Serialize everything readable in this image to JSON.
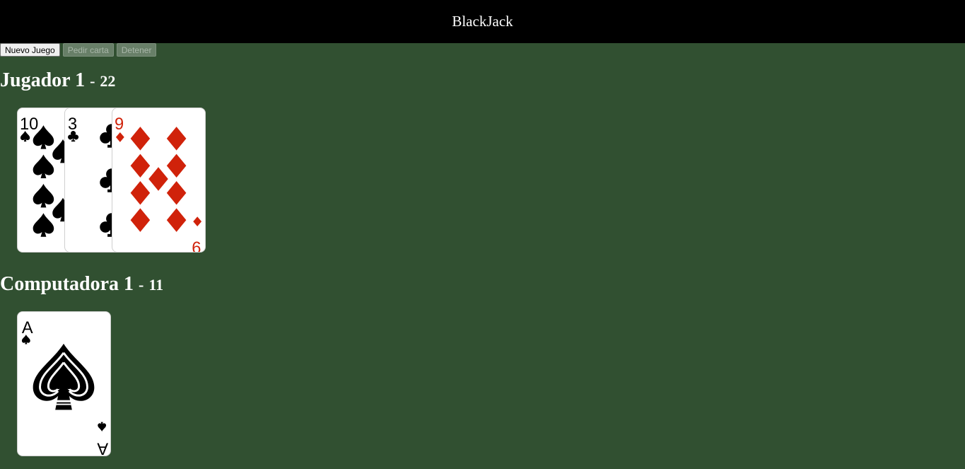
{
  "header": {
    "title": "BlackJack"
  },
  "controls": {
    "new_game": "Nuevo Juego",
    "hit": "Pedir carta",
    "stand": "Detener"
  },
  "player": {
    "name": "Jugador 1",
    "separator": "-",
    "score": "22",
    "cards": [
      {
        "rank": "10",
        "suit": "spades"
      },
      {
        "rank": "3",
        "suit": "clubs"
      },
      {
        "rank": "9",
        "suit": "diamonds"
      }
    ]
  },
  "computer": {
    "name": "Computadora 1",
    "separator": "-",
    "score": "11",
    "cards": [
      {
        "rank": "A",
        "suit": "spades"
      }
    ]
  },
  "colors": {
    "table": "#315031",
    "topbar": "#000000",
    "red_suit": "#d0220a",
    "black_suit": "#000000"
  }
}
